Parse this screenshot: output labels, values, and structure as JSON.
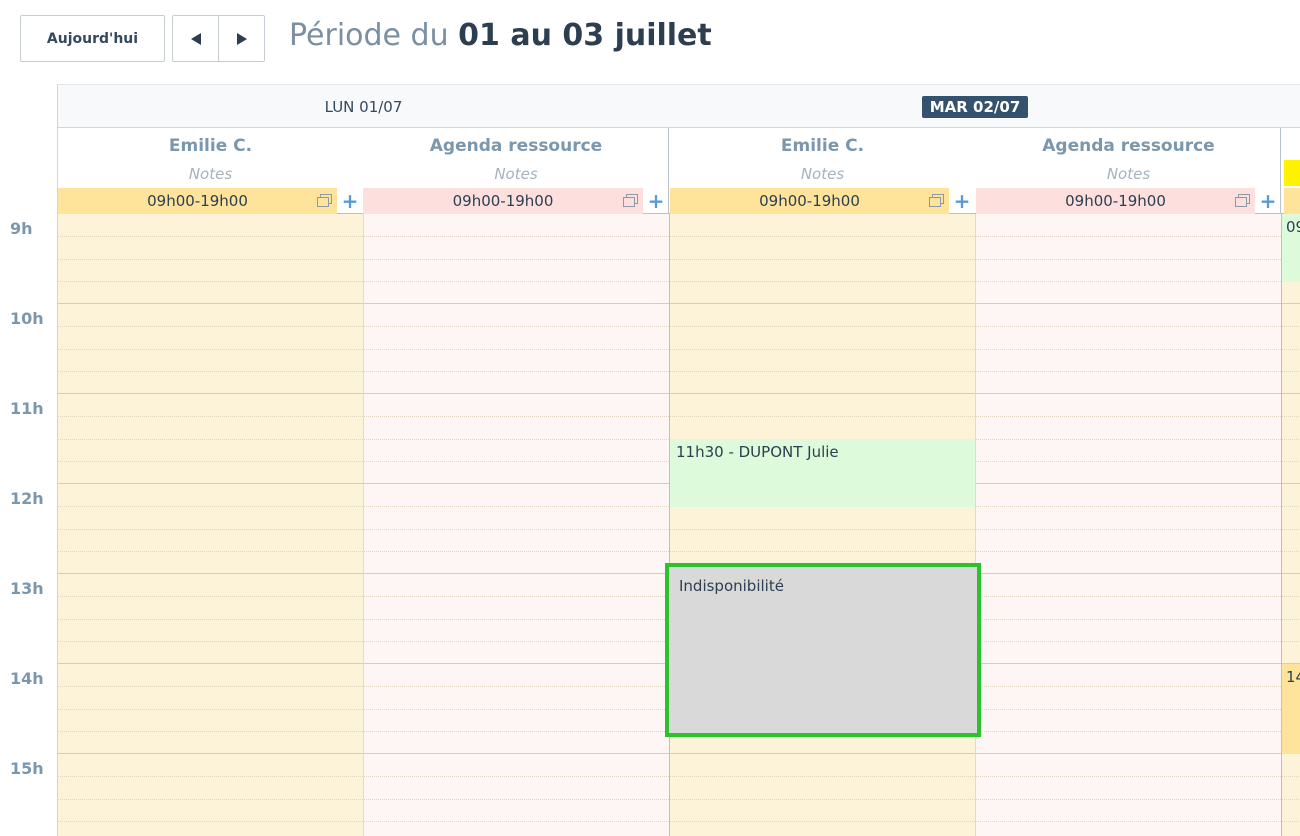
{
  "toolbar": {
    "today_label": "Aujourd'hui",
    "title_prefix": "Période du ",
    "title_range": "01 au 03 juillet"
  },
  "days": [
    {
      "label": "LUN 01/07",
      "today": false
    },
    {
      "label": "MAR 02/07",
      "today": true
    }
  ],
  "resources": [
    {
      "name": "Emilie C.",
      "notes": "Notes",
      "hours": "09h00-19h00",
      "hours_color": "#fde49a",
      "bg_color": "#fdf3d9"
    },
    {
      "name": "Agenda ressource",
      "notes": "Notes",
      "hours": "09h00-19h00",
      "hours_color": "#fde0dd",
      "bg_color": "#fef6f4"
    },
    {
      "name": "Emilie C.",
      "notes": "Notes",
      "hours": "09h00-19h00",
      "hours_color": "#fde49a",
      "bg_color": "#fdf3d9"
    },
    {
      "name": "Agenda ressource",
      "notes": "Notes",
      "hours": "09h00-19h00",
      "hours_color": "#fde0dd",
      "bg_color": "#fef6f4"
    }
  ],
  "hours": [
    "9h",
    "10h",
    "11h",
    "12h",
    "13h",
    "14h",
    "15h"
  ],
  "events": {
    "appointment": {
      "label": "11h30 - DUPONT Julie",
      "color": "#ddfadb"
    },
    "unavailable": {
      "label": "Indisponibilité",
      "color": "#d9d9d9",
      "outline": "#2ec12e"
    },
    "partial_top": {
      "label": "09",
      "color": "#ddfadb"
    },
    "partial_bottom": {
      "label": "14",
      "color": "#fde49a"
    }
  },
  "colors": {
    "today_badge": "#34526e",
    "partial_header": "#fff200",
    "accent_plus": "#5b9bd5"
  }
}
